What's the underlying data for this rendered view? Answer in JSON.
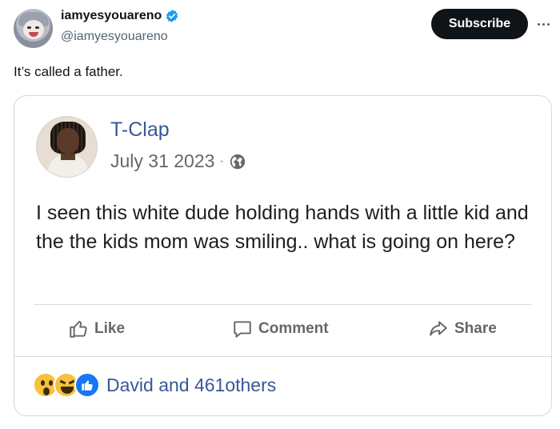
{
  "tweet": {
    "display_name": "iamyesyouareno",
    "handle": "@iamyesyouareno",
    "subscribe_label": "Subscribe",
    "text": "It’s called a father."
  },
  "embedded_post": {
    "author": "T-Clap",
    "date": "July 31 2023",
    "separator": "·",
    "body": "I seen this white dude holding hands with a little kid and the the kids mom was smiling.. what is going on here?",
    "actions": {
      "like": "Like",
      "comment": "Comment",
      "share": "Share"
    },
    "reactions_text": "David and 461others"
  },
  "colors": {
    "fb_blue": "#385898",
    "like_blue": "#1877f2",
    "verified_blue": "#1d9bf0",
    "subscribe_bg": "#0f1419"
  },
  "icons": {
    "verified": "verified-badge-icon",
    "more": "more-dots-icon",
    "globe": "globe-icon",
    "like": "thumbs-up-icon",
    "comment": "comment-icon",
    "share": "share-arrow-icon",
    "reaction_wow": "wow-reaction-icon",
    "reaction_haha": "haha-reaction-icon",
    "reaction_like": "like-reaction-icon"
  }
}
